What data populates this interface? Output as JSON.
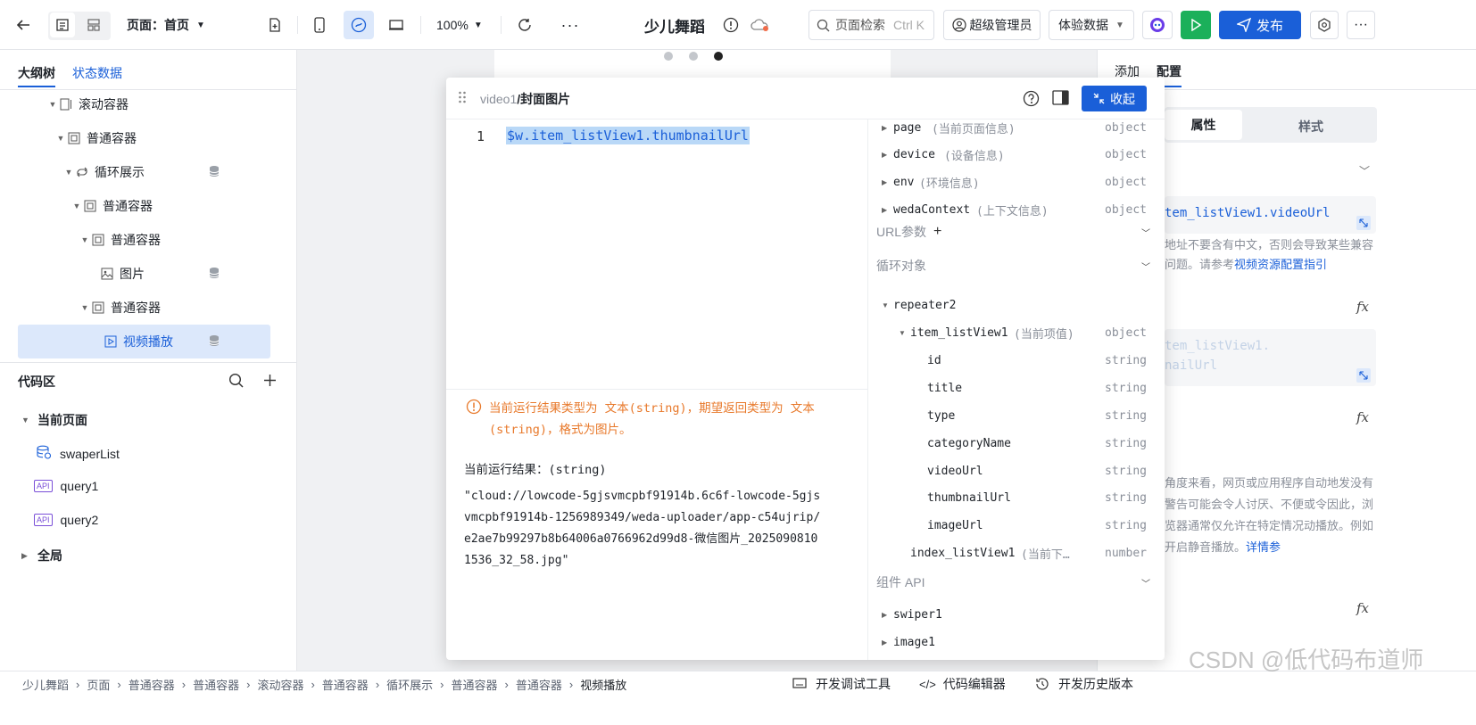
{
  "topbar": {
    "page_label": "页面：首页",
    "zoom": "100%",
    "app_title": "少儿舞蹈",
    "search_placeholder": "页面检索",
    "search_shortcut": "Ctrl K",
    "role": "超级管理员",
    "data_mode": "体验数据",
    "publish": "发布"
  },
  "left": {
    "tabs": [
      "大纲树",
      "状态数据"
    ],
    "tree": [
      {
        "label": "滚动容器"
      },
      {
        "label": "普通容器"
      },
      {
        "label": "循环展示"
      },
      {
        "label": "普通容器"
      },
      {
        "label": "普通容器"
      },
      {
        "label": "图片"
      },
      {
        "label": "普通容器"
      },
      {
        "label": "视频播放"
      }
    ],
    "code_title": "代码区",
    "current_page": "当前页面",
    "code_items": [
      "swaperList",
      "query1",
      "query2"
    ],
    "api_badge": "API",
    "global": "全局"
  },
  "modal": {
    "path_prefix": "video1",
    "path_title": "/封面图片",
    "collapse": "收起",
    "line_no": "1",
    "expression": "$w.item_listView1.thumbnailUrl",
    "warning": "当前运行结果类型为 文本(string)，期望返回类型为 文本(string)，格式为图片。",
    "result_label": "当前运行结果：(string)",
    "result_value": "\"cloud://lowcode-5gjsvmcpbf91914b.6c6f-lowcode-5gjsvmcpbf91914b-1256989349/weda-uploader/app-c54ujrip/e2ae7b99297b8b64006a0766962d99d8-微信图片_20250908101536_32_58.jpg\"",
    "vars": [
      {
        "name": "page",
        "desc": "(当前页面信息)",
        "type": "object"
      },
      {
        "name": "device",
        "desc": "(设备信息)",
        "type": "object"
      },
      {
        "name": "env",
        "desc": "(环境信息)",
        "type": "object"
      },
      {
        "name": "wedaContext",
        "desc": "(上下文信息)",
        "type": "object"
      }
    ],
    "url_params": "URL参数",
    "loop_obj": "循环对象",
    "repeater": "repeater2",
    "item_list": {
      "name": "item_listView1",
      "desc": "(当前项值)",
      "type": "object"
    },
    "fields": [
      {
        "name": "id",
        "type": "string"
      },
      {
        "name": "title",
        "type": "string"
      },
      {
        "name": "type",
        "type": "string"
      },
      {
        "name": "categoryName",
        "type": "string"
      },
      {
        "name": "videoUrl",
        "type": "string"
      },
      {
        "name": "thumbnailUrl",
        "type": "string"
      },
      {
        "name": "imageUrl",
        "type": "string"
      }
    ],
    "index_list": {
      "name": "index_listView1",
      "desc": "(当前下…",
      "type": "number"
    },
    "comp_api": "组件 API",
    "components": [
      "swiper1",
      "image1"
    ]
  },
  "right": {
    "tabs": [
      "添加",
      "配置"
    ],
    "seg": [
      "属性",
      "样式"
    ],
    "video_url": "tem_listView1.videoUrl",
    "hint": "地址不要含有中文，否则会导致某些兼容问题。请参考",
    "hint_link": "视频资源配置指引",
    "cover_expr_1": "tem_listView1.",
    "cover_expr_2": "nailUrl",
    "fx": "fx",
    "autoplay_hint": "角度来看，网页或应用程序自动地发没有警告可能会令人讨厌、不便或令因此，浏览器通常仅允许在特定情况动播放。例如开启静音播放。",
    "autoplay_link": "详情参"
  },
  "bottom": {
    "crumbs": [
      "少儿舞蹈",
      "页面",
      "普通容器",
      "普通容器",
      "滚动容器",
      "普通容器",
      "循环展示",
      "普通容器",
      "普通容器",
      "视频播放"
    ],
    "tools": [
      "开发调试工具",
      "代码编辑器",
      "开发历史版本"
    ],
    "watermark": "CSDN @低代码布道师"
  },
  "colors": {
    "primary": "#1a5fd8",
    "success": "#1bb05a",
    "warn": "#e8792b",
    "selected_bg": "#dce8fb"
  }
}
